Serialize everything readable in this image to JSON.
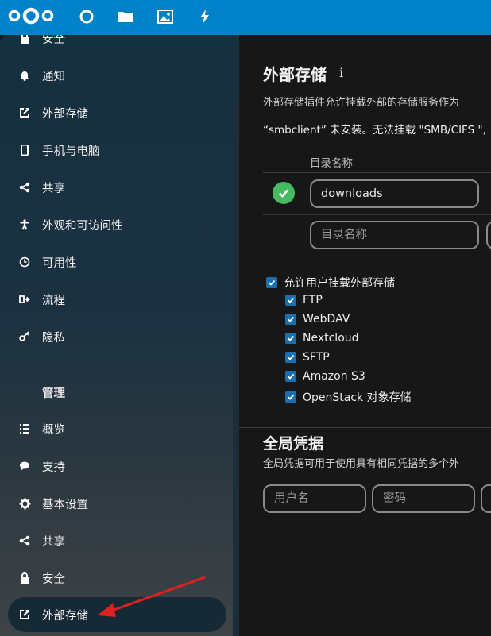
{
  "header": {
    "apps": [
      "dashboard-icon",
      "files-icon",
      "photos-icon",
      "activity-icon"
    ],
    "color": "#0082c9"
  },
  "sidebar": {
    "personal_items": [
      {
        "label": "安全",
        "icon": "lock-icon"
      },
      {
        "label": "通知",
        "icon": "bell-icon"
      },
      {
        "label": "外部存储",
        "icon": "external-storage-icon"
      },
      {
        "label": "手机与电脑",
        "icon": "phone-icon"
      },
      {
        "label": "共享",
        "icon": "share-icon"
      },
      {
        "label": "外观和可访问性",
        "icon": "accessibility-icon"
      },
      {
        "label": "可用性",
        "icon": "clock-icon"
      },
      {
        "label": "流程",
        "icon": "flow-icon"
      },
      {
        "label": "隐私",
        "icon": "key-icon"
      }
    ],
    "admin_caption": "管理",
    "admin_items": [
      {
        "label": "概览",
        "icon": "overview-icon"
      },
      {
        "label": "支持",
        "icon": "support-icon"
      },
      {
        "label": "基本设置",
        "icon": "gear-icon"
      },
      {
        "label": "共享",
        "icon": "share-icon"
      },
      {
        "label": "安全",
        "icon": "lock-icon"
      },
      {
        "label": "外部存储",
        "icon": "external-storage-icon",
        "active": true
      }
    ]
  },
  "main": {
    "title": "外部存储",
    "info_glyph": "i",
    "description": "外部存储插件允许挂载外部的存储服务作为",
    "warning": "“smbclient” 未安装。无法挂载 \"SMB/CIFS \",",
    "column_header": "目录名称",
    "mounts": [
      {
        "folder_name": "downloads",
        "status": "ok"
      }
    ],
    "new_folder_placeholder": "目录名称",
    "allow_user_mounting": "允许用户挂载外部存储",
    "backends": [
      "FTP",
      "WebDAV",
      "Nextcloud",
      "SFTP",
      "Amazon S3",
      "OpenStack 对象存储"
    ],
    "global_credentials": {
      "title": "全局凭据",
      "description": "全局凭据可用于使用具有相同凭据的多个外",
      "username_placeholder": "用户名",
      "password_placeholder": "密码"
    }
  },
  "colors": {
    "accent": "#0082c9",
    "success": "#46ba61",
    "checkbox": "#1a6fb0",
    "annotation_arrow": "#e02020"
  }
}
